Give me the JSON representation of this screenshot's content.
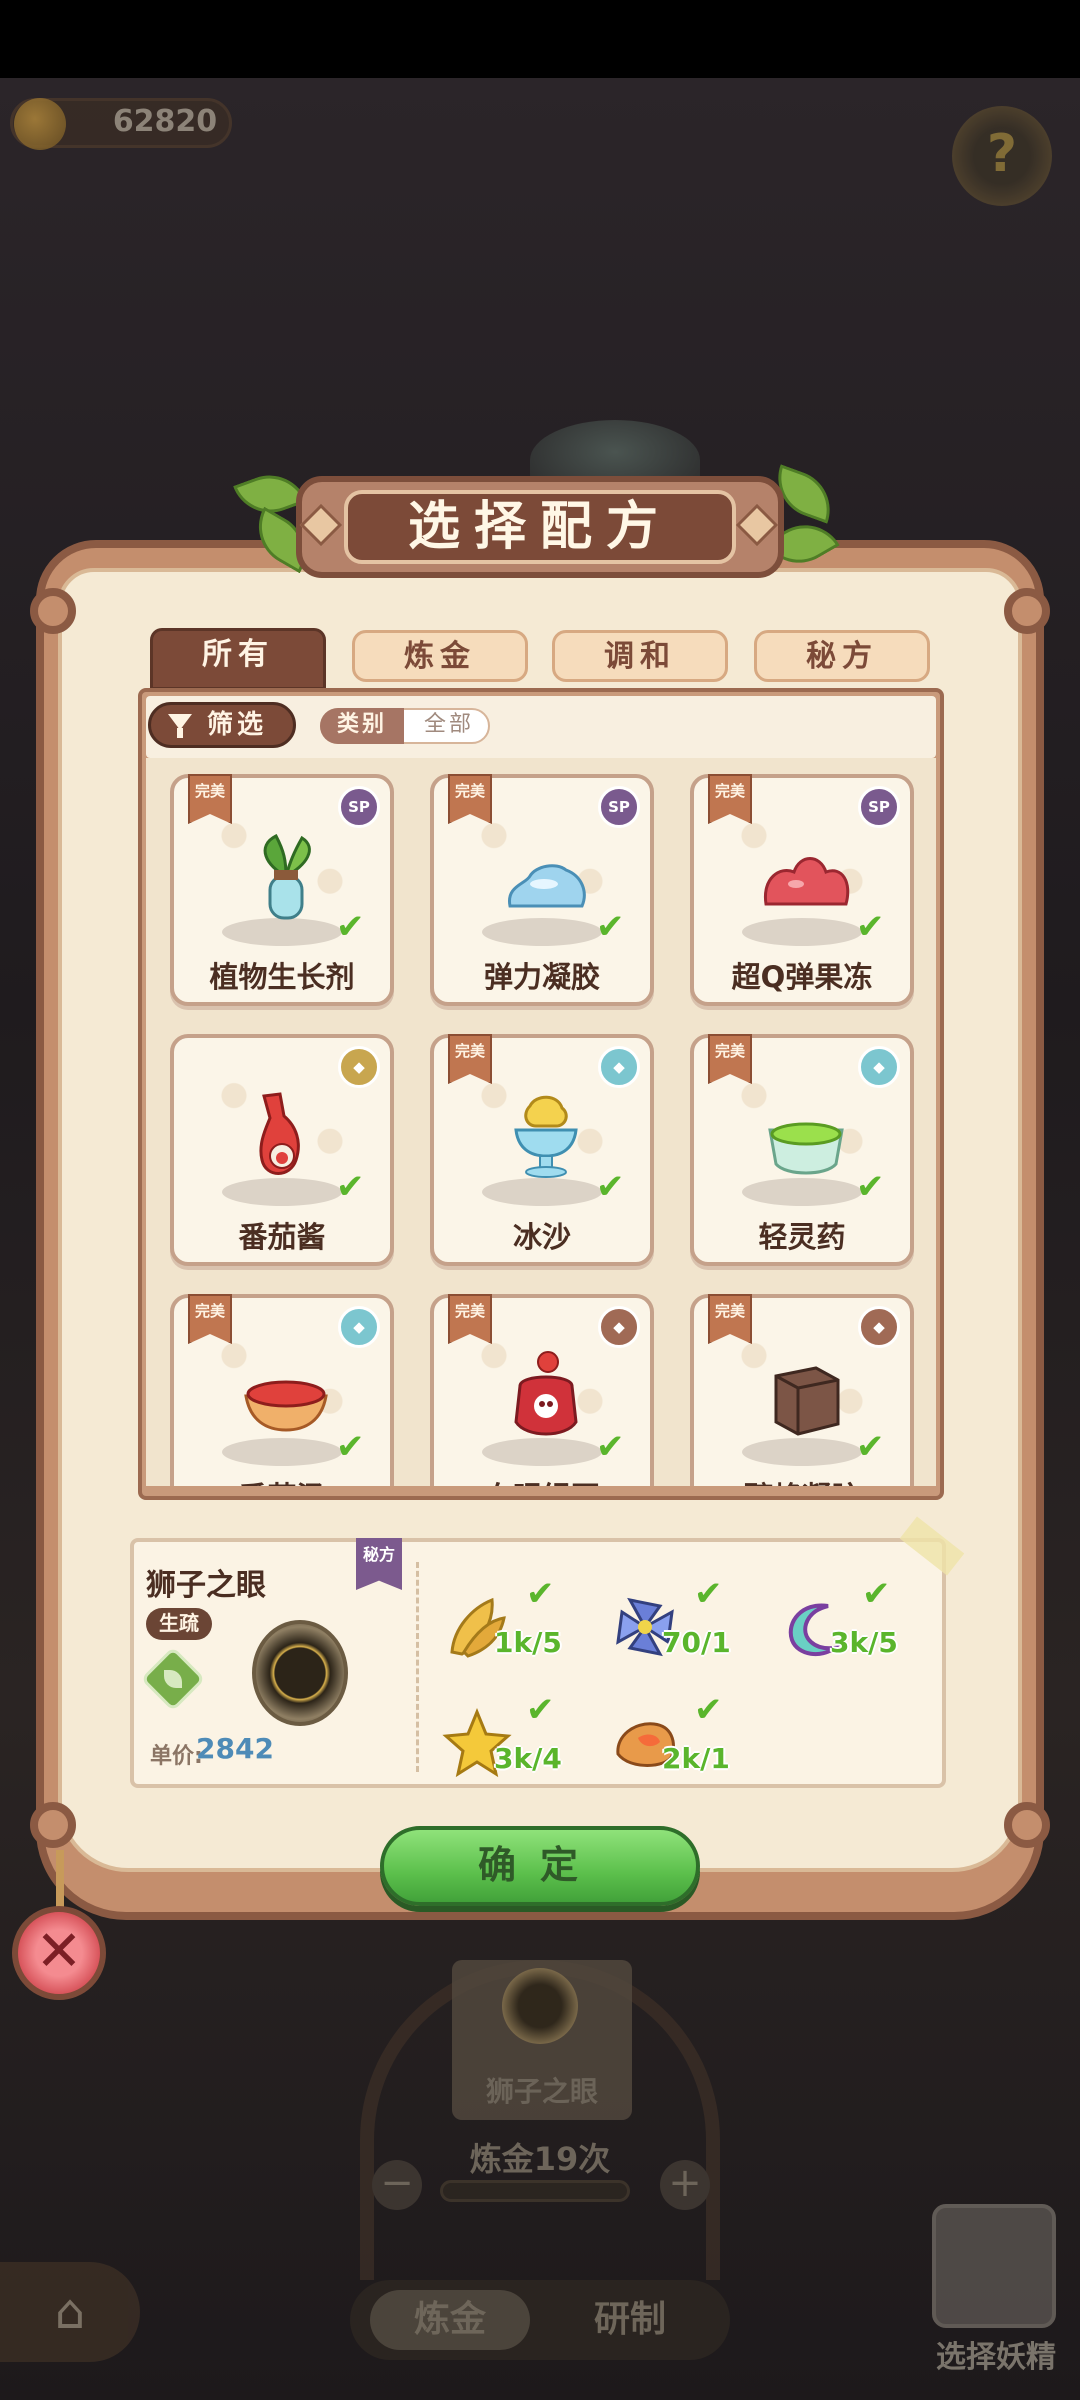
{
  "hud": {
    "coins": "62820",
    "help_icon": "question-leaf-icon"
  },
  "dialog": {
    "title": "选择配方",
    "tabs": [
      {
        "label": "所有",
        "active": true
      },
      {
        "label": "炼金",
        "active": false
      },
      {
        "label": "调和",
        "active": false
      },
      {
        "label": "秘方",
        "active": false
      }
    ],
    "filter_label": "筛选",
    "category_label": "类别",
    "category_value": "全部",
    "perfect_tag": "完美",
    "recipes": [
      {
        "name": "植物生长剂",
        "perfect": true,
        "rarity": "SP",
        "icon": "plant-potion-icon"
      },
      {
        "name": "弹力凝胶",
        "perfect": true,
        "rarity": "SP",
        "icon": "blue-gel-icon"
      },
      {
        "name": "超Q弹果冻",
        "perfect": true,
        "rarity": "SP",
        "icon": "red-jelly-icon"
      },
      {
        "name": "番茄酱",
        "perfect": false,
        "rarity": "gold",
        "icon": "ketchup-bottle-icon"
      },
      {
        "name": "冰沙",
        "perfect": true,
        "rarity": "teal",
        "icon": "shaved-ice-icon"
      },
      {
        "name": "轻灵药",
        "perfect": true,
        "rarity": "teal",
        "icon": "green-potion-icon"
      },
      {
        "name": "番茄汤",
        "perfect": true,
        "rarity": "teal",
        "icon": "tomato-soup-icon"
      },
      {
        "name": "血眼绿豆",
        "perfect": true,
        "rarity": "brown",
        "icon": "skull-jar-icon"
      },
      {
        "name": "醇蜂凝胶",
        "perfect": true,
        "rarity": "brown",
        "icon": "brown-cube-icon"
      }
    ],
    "detail": {
      "name": "狮子之眼",
      "tag": "生疏",
      "secret_badge": "秘方",
      "price_label": "单价:",
      "price_value": "2842",
      "ingredients": [
        {
          "icon": "golden-wheat-icon",
          "count": "1k/5"
        },
        {
          "icon": "pinwheel-flower-icon",
          "count": "70/1"
        },
        {
          "icon": "rainbow-crescent-icon",
          "count": "3k/5"
        },
        {
          "icon": "gold-star-icon",
          "count": "3k/4"
        },
        {
          "icon": "amber-stone-icon",
          "count": "2k/1"
        }
      ]
    },
    "confirm_label": "确定"
  },
  "background": {
    "card_label": "狮子之眼",
    "alchemy_count": "炼金19次",
    "bottom_tabs": [
      "炼金",
      "研制"
    ],
    "fairy_label": "选择妖精"
  },
  "colors": {
    "frame": "#c48e6d",
    "frame_dark": "#7c4a38",
    "panel": "#f5ead4",
    "confirm_green": "#5cc04c",
    "check_green": "#5ab52c",
    "price_blue": "#4e8bb7"
  }
}
